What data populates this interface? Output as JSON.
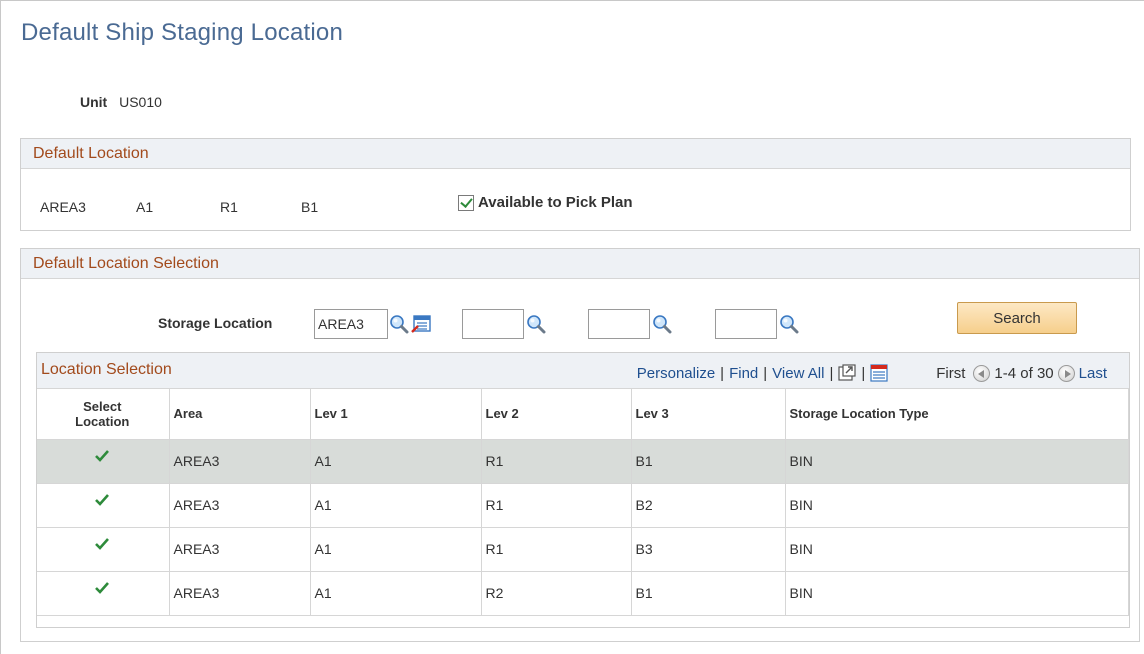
{
  "page": {
    "title": "Default Ship Staging Location",
    "unit_label": "Unit",
    "unit_value": "US010"
  },
  "default_location": {
    "header": "Default Location",
    "area": "AREA3",
    "lev1": "A1",
    "lev2": "R1",
    "lev3": "B1",
    "available_label": "Available to Pick Plan",
    "available_checked": true
  },
  "selection": {
    "header": "Default Location Selection",
    "storage_label": "Storage Location",
    "storage_values": [
      "AREA3",
      "",
      "",
      ""
    ],
    "search_label": "Search"
  },
  "grid": {
    "title": "Location Selection",
    "nav": {
      "personalize": "Personalize",
      "find": "Find",
      "view_all": "View All",
      "first": "First",
      "range": "1-4 of 30",
      "last": "Last",
      "sep": "|"
    },
    "columns": [
      "Select Location",
      "Area",
      "Lev 1",
      "Lev 2",
      "Lev 3",
      "Storage Location Type"
    ],
    "rows": [
      {
        "area": "AREA3",
        "lev1": "A1",
        "lev2": "R1",
        "lev3": "B1",
        "type": "BIN",
        "selected": true
      },
      {
        "area": "AREA3",
        "lev1": "A1",
        "lev2": "R1",
        "lev3": "B2",
        "type": "BIN",
        "selected": false
      },
      {
        "area": "AREA3",
        "lev1": "A1",
        "lev2": "R1",
        "lev3": "B3",
        "type": "BIN",
        "selected": false
      },
      {
        "area": "AREA3",
        "lev1": "A1",
        "lev2": "R2",
        "lev3": "B1",
        "type": "BIN",
        "selected": false
      }
    ]
  },
  "colors": {
    "title": "#4a6a93",
    "section_header": "#a24a1c",
    "link": "#1f4f8f",
    "check_green": "#2e8b3b",
    "selected_row": "#d8dcd9"
  }
}
